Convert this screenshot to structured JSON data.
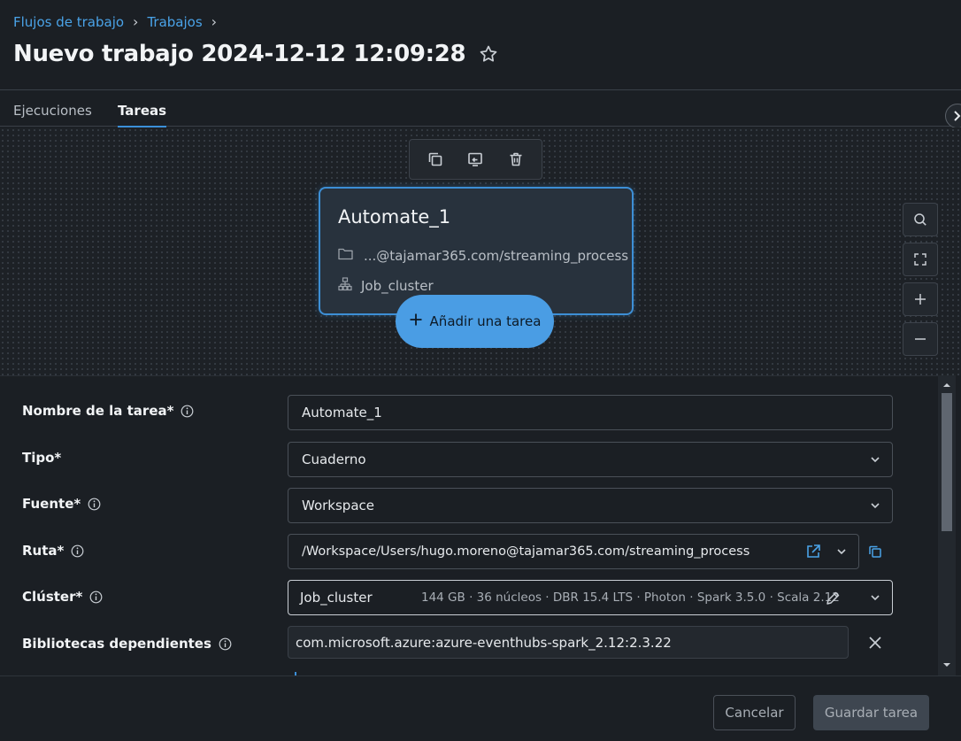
{
  "breadcrumb": {
    "items": [
      "Flujos de trabajo",
      "Trabajos"
    ],
    "sep": "›"
  },
  "title": "Nuevo trabajo 2024-12-12 12:09:28",
  "tabs": [
    {
      "label": "Ejecuciones",
      "active": false
    },
    {
      "label": "Tareas",
      "active": true
    }
  ],
  "node": {
    "title": "Automate_1",
    "path": "...@tajamar365.com/streaming_process",
    "cluster": "Job_cluster"
  },
  "add_task_label": "Añadir una tarea",
  "form": {
    "task_name": {
      "label": "Nombre de la tarea*",
      "value": "Automate_1"
    },
    "type": {
      "label": "Tipo*",
      "value": "Cuaderno"
    },
    "source": {
      "label": "Fuente*",
      "value": "Workspace"
    },
    "path": {
      "label": "Ruta*",
      "value": "/Workspace/Users/hugo.moreno@tajamar365.com/streaming_process"
    },
    "cluster": {
      "label": "Clúster*",
      "name": "Job_cluster",
      "details": "144 GB · 36 núcleos · DBR 15.4 LTS · Photon · Spark 3.5.0 · Scala 2.12"
    },
    "libraries": {
      "label": "Bibliotecas dependientes",
      "value": "com.microsoft.azure:azure-eventhubs-spark_2.12:2.3.22"
    }
  },
  "footer": {
    "cancel": "Cancelar",
    "save": "Guardar tarea"
  },
  "colors": {
    "accent": "#3b8fd9",
    "link": "#4aa3e8",
    "background": "#1b1f24",
    "node_border": "#3d8fd6"
  }
}
